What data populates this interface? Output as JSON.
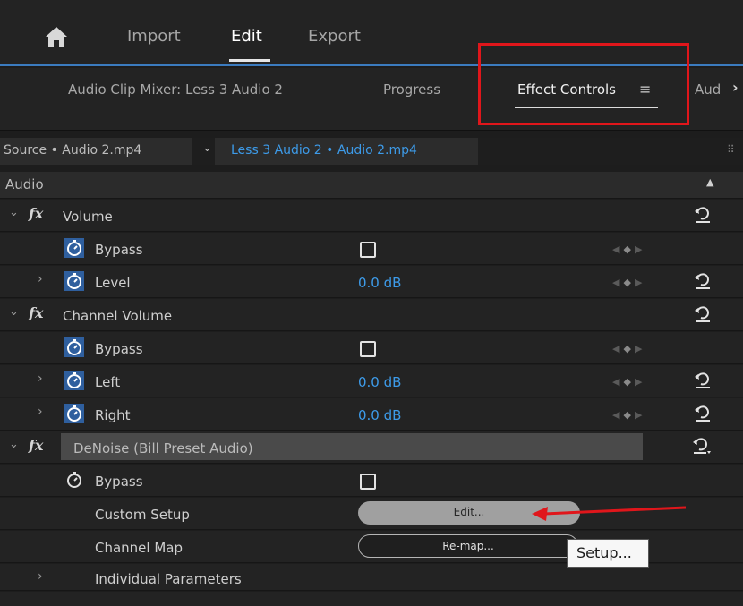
{
  "topnav": {
    "items": [
      {
        "label": "Import"
      },
      {
        "label": "Edit",
        "active": true
      },
      {
        "label": "Export"
      }
    ]
  },
  "panel_tabs": [
    {
      "label": "Audio Clip Mixer: Less 3 Audio 2"
    },
    {
      "label": "Progress"
    },
    {
      "label": "Effect Controls",
      "active": true
    },
    {
      "label": "Aud"
    }
  ],
  "source_bar": {
    "source": "Source • Audio 2.mp4",
    "sequence": "Less 3 Audio 2 • Audio 2.mp4"
  },
  "effects": {
    "section_label": "Audio",
    "volume": {
      "name": "Volume",
      "bypass_label": "Bypass",
      "level_label": "Level",
      "level_value": "0.0 dB"
    },
    "channel_volume": {
      "name": "Channel Volume",
      "bypass_label": "Bypass",
      "left_label": "Left",
      "left_value": "0.0 dB",
      "right_label": "Right",
      "right_value": "0.0 dB"
    },
    "denoise": {
      "name": "DeNoise (Bill Preset Audio)",
      "bypass_label": "Bypass",
      "custom_setup_label": "Custom Setup",
      "custom_setup_button": "Edit...",
      "channel_map_label": "Channel Map",
      "channel_map_button": "Re-map...",
      "individual_params_label": "Individual Parameters"
    }
  },
  "tooltip": {
    "text": "Setup..."
  },
  "colors": {
    "accent_blue": "#3d9be9",
    "annotation_red": "#e0161b",
    "panel_bg": "#232323"
  }
}
